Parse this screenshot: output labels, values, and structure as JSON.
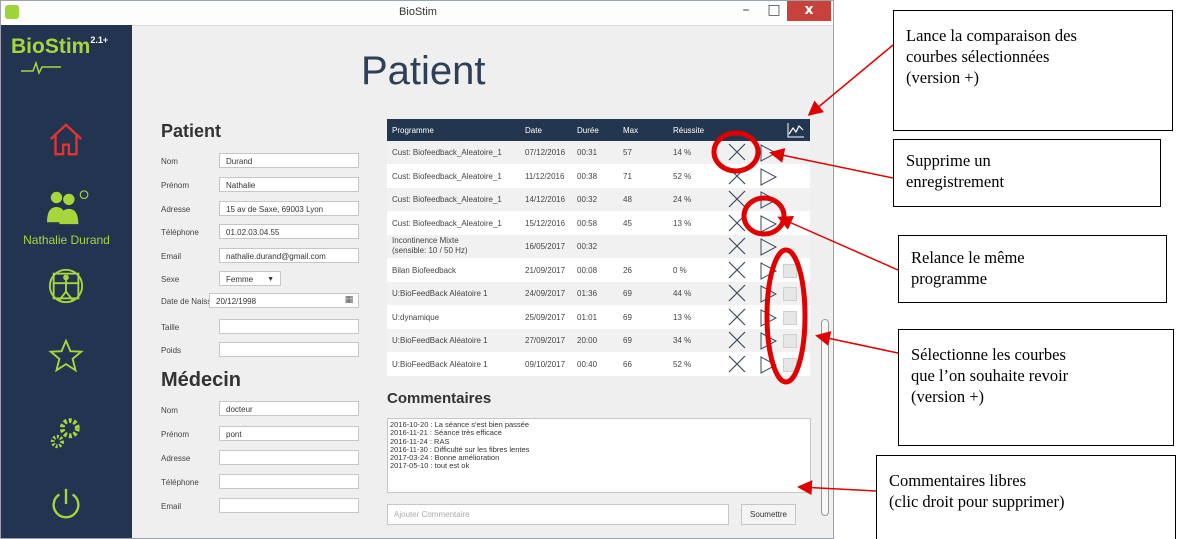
{
  "window": {
    "title": "BioStim",
    "minimize": "–",
    "maximize": "□",
    "close": "x"
  },
  "sidebar": {
    "logo": "BioStim",
    "logo_version": "2.1+",
    "user_name": "Nathalie Durand",
    "icons": [
      "home-icon",
      "user-icon",
      "vitruvian-icon",
      "star-icon",
      "gears-icon",
      "power-icon"
    ],
    "accent_color": "#a6d63c",
    "home_color": "#e3342f"
  },
  "page": {
    "title": "Patient"
  },
  "patient": {
    "heading": "Patient",
    "fields": {
      "nom": {
        "label": "Nom",
        "value": "Durand"
      },
      "prenom": {
        "label": "Prénom",
        "value": "Nathalie"
      },
      "adresse": {
        "label": "Adresse",
        "value": "15 av de Saxe, 69003 Lyon"
      },
      "telephone": {
        "label": "Téléphone",
        "value": "01.02.03.04.55"
      },
      "email": {
        "label": "Email",
        "value": "nathalie.durand@gmail.com"
      },
      "sexe": {
        "label": "Sexe",
        "value": "Femme"
      },
      "naissance": {
        "label": "Date de Naissance",
        "value": "20/12/1998"
      },
      "taille": {
        "label": "Taille",
        "value": ""
      },
      "poids": {
        "label": "Poids",
        "value": ""
      }
    }
  },
  "medecin": {
    "heading": "Médecin",
    "fields": {
      "nom": {
        "label": "Nom",
        "value": "docteur"
      },
      "prenom": {
        "label": "Prénom",
        "value": "pont"
      },
      "adresse": {
        "label": "Adresse",
        "value": ""
      },
      "telephone": {
        "label": "Téléphone",
        "value": ""
      },
      "email": {
        "label": "Email",
        "value": ""
      }
    }
  },
  "table": {
    "columns": [
      "Programme",
      "Date",
      "Durée",
      "Max",
      "Réussite"
    ],
    "rows": [
      {
        "programme": "Cust: Biofeedback_Aleatoire_1",
        "date": "07/12/2016",
        "duree": "00:31",
        "max": "57",
        "reussite": "14 %",
        "checkbox": false
      },
      {
        "programme": "Cust: Biofeedback_Aleatoire_1",
        "date": "11/12/2016",
        "duree": "00:38",
        "max": "71",
        "reussite": "52 %",
        "checkbox": false
      },
      {
        "programme": "Cust: Biofeedback_Aleatoire_1",
        "date": "14/12/2016",
        "duree": "00:32",
        "max": "48",
        "reussite": "24 %",
        "checkbox": false
      },
      {
        "programme": "Cust: Biofeedback_Aleatoire_1",
        "date": "15/12/2016",
        "duree": "00:58",
        "max": "45",
        "reussite": "13 %",
        "checkbox": false
      },
      {
        "programme": "Incontinence Mixte",
        "programme2": "(sensible: 10 / 50 Hz)",
        "date": "16/05/2017",
        "duree": "00:32",
        "max": "",
        "reussite": "",
        "checkbox": false
      },
      {
        "programme": "Bilan Biofeedback",
        "date": "21/09/2017",
        "duree": "00:08",
        "max": "26",
        "reussite": "0 %",
        "checkbox": true
      },
      {
        "programme": "U:BioFeedBack Aléatoire 1",
        "date": "24/09/2017",
        "duree": "01:36",
        "max": "69",
        "reussite": "44 %",
        "checkbox": true
      },
      {
        "programme": "U:dynamique",
        "date": "25/09/2017",
        "duree": "01:01",
        "max": "69",
        "reussite": "13 %",
        "checkbox": true
      },
      {
        "programme": "U:BioFeedBack Aléatoire 1",
        "date": "27/09/2017",
        "duree": "20:00",
        "max": "69",
        "reussite": "34 %",
        "checkbox": true
      },
      {
        "programme": "U:BioFeedBack Aléatoire 1",
        "date": "09/10/2017",
        "duree": "00:40",
        "max": "66",
        "reussite": "52 %",
        "checkbox": true
      }
    ],
    "compare_icon": "line-chart-icon"
  },
  "comments": {
    "heading": "Commentaires",
    "lines": [
      "2016-10-20 : La séance s'est bien passée",
      "2016-11-21 : Séance très efficace",
      "2016-11-24 : RAS",
      "2016-11-30 : Difficulté sur les fibres lentes",
      "2017-03-24 : Bonne amélioration",
      "2017-05-10 : tout est ok"
    ],
    "add_placeholder": "Ajouter Commentaire",
    "submit_label": "Soumettre"
  },
  "annotations": [
    [
      "Lance la comparaison des",
      "courbes sélectionnées",
      "(version +)"
    ],
    [
      "Supprime un",
      "enregistrement"
    ],
    [
      "Relance le même",
      "programme"
    ],
    [
      "Sélectionne les courbes",
      "que l’on souhaite revoir",
      "(version +)"
    ],
    [
      "Commentaires libres",
      "(clic droit pour supprimer)"
    ]
  ],
  "colors": {
    "sidebar": "#22344f",
    "table_header": "#233650",
    "annotation_red": "#e00000"
  }
}
